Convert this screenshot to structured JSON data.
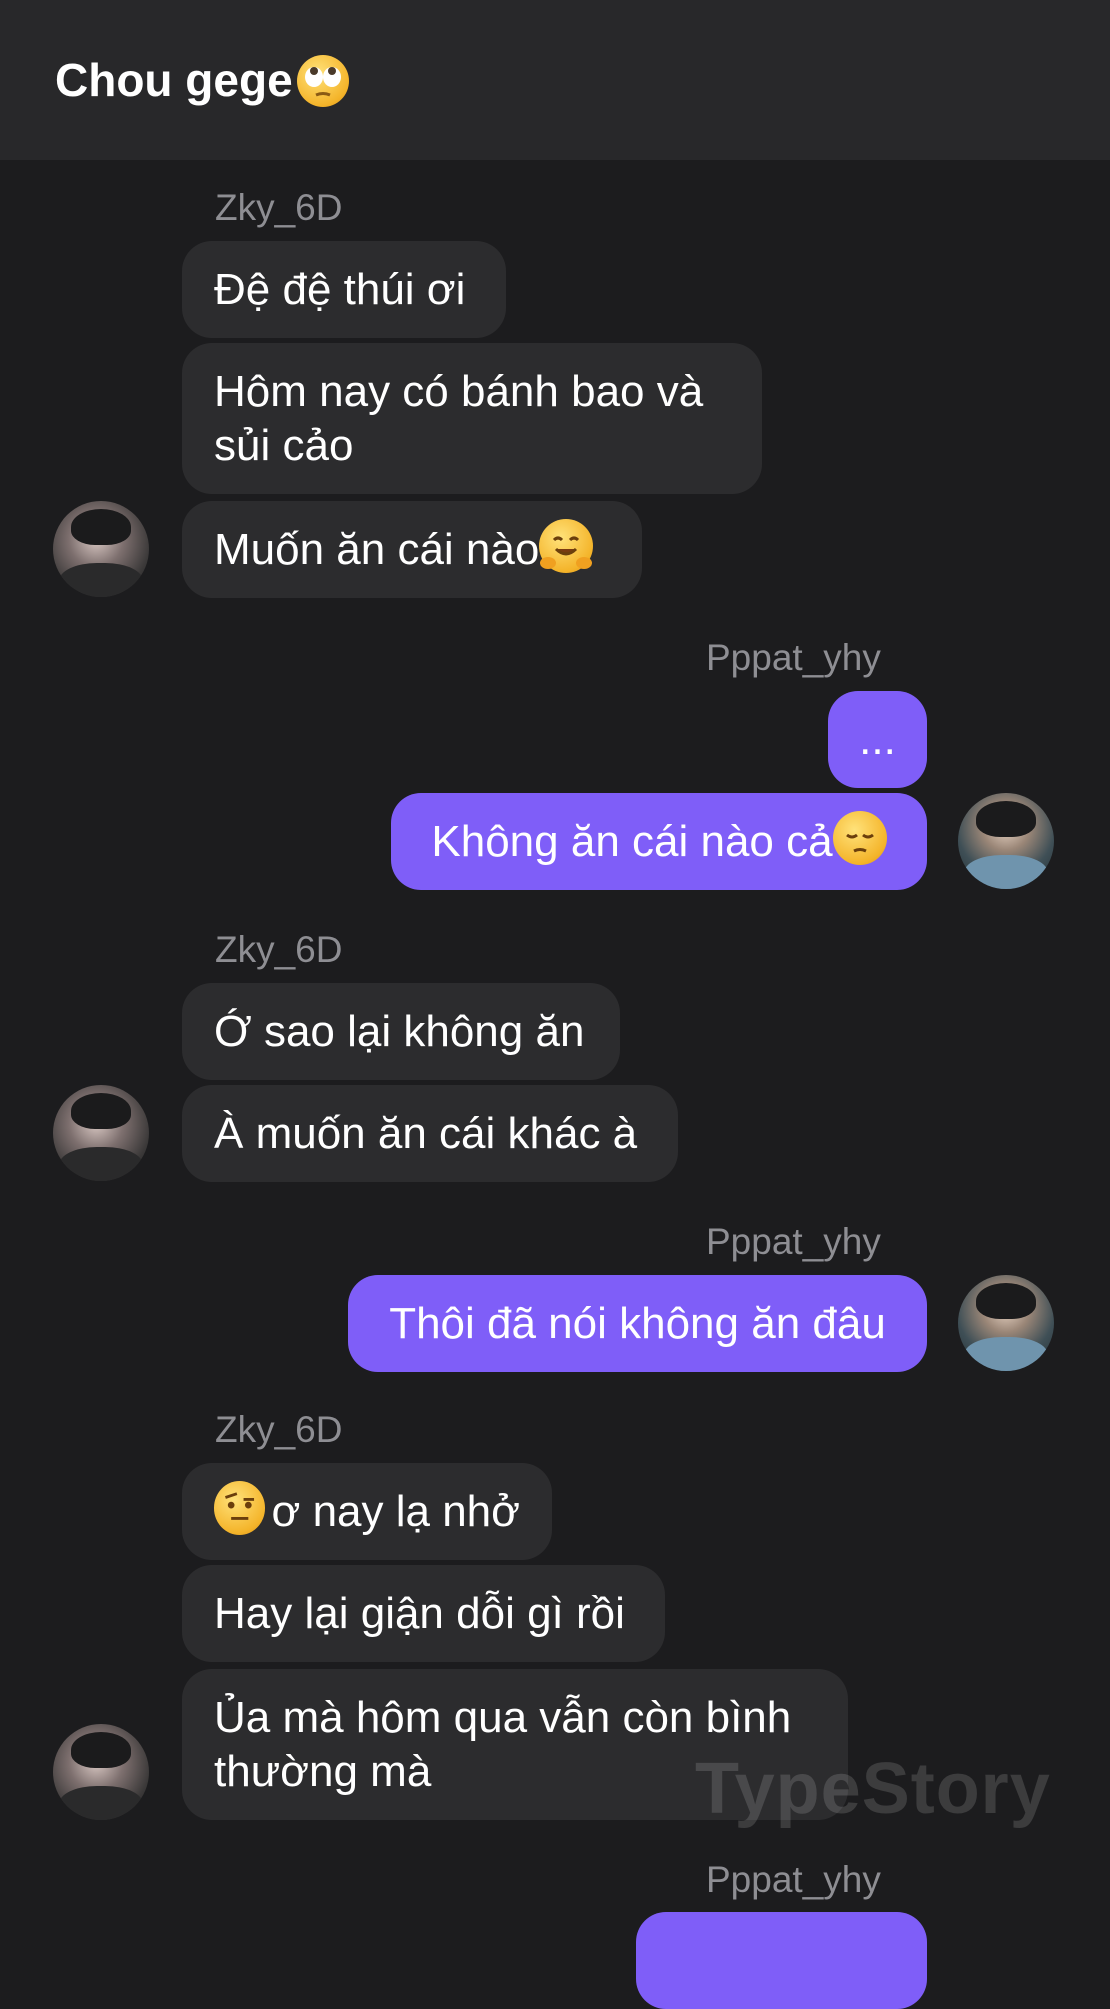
{
  "header": {
    "title": "Chou gege",
    "title_emoji": "face-with-rolling-eyes-emoji"
  },
  "names": {
    "g1": "Zky_6D",
    "g2": "Pppat_yhy",
    "g3": "Zky_6D",
    "g4": "Pppat_yhy",
    "g5": "Zky_6D",
    "g6": "Pppat_yhy"
  },
  "messages": {
    "m1": "Đệ đệ thúi ơi",
    "m2": "Hôm nay có bánh bao và sủi cảo",
    "m3": "Muốn ăn cái nào",
    "m4": "...",
    "m5": "Không ăn cái nào cả",
    "m6": "Ớ sao lại không ăn",
    "m7": "À muốn ăn cái khác à",
    "m8": "Thôi đã nói không ăn đâu",
    "m9": "ơ nay lạ nhở",
    "m10": "Hay lại giận dỗi gì rồi",
    "m11": "Ủa mà hôm qua vẫn còn bình thường mà"
  },
  "emojis": {
    "m3": "hugging-face-emoji",
    "m5": "pensive-face-emoji",
    "m9": "face-with-raised-eyebrow-emoji"
  },
  "watermark": "TypeStory",
  "colors": {
    "background": "#1c1c1e",
    "header": "#28282a",
    "incoming_bubble": "#2c2c2e",
    "outgoing_bubble": "#7f5ef8",
    "name": "#8e8e93"
  }
}
